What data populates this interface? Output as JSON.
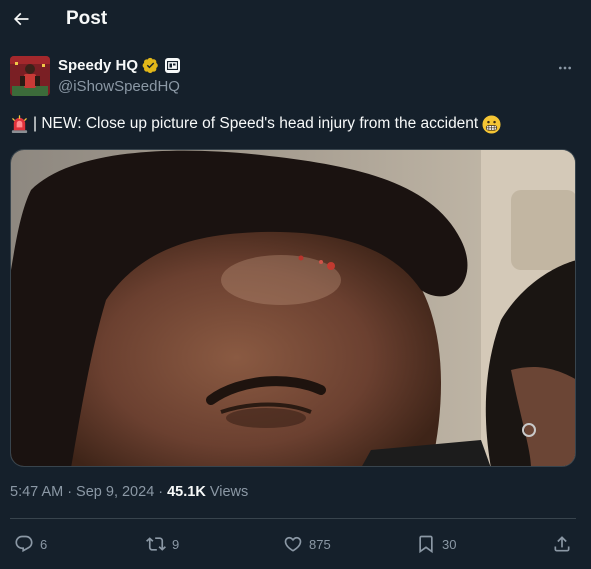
{
  "header": {
    "title": "Post"
  },
  "author": {
    "display_name": "Speedy HQ",
    "handle": "@iShowSpeedHQ"
  },
  "tweet": {
    "text": "| NEW: Close up picture of Speed's head injury from the accident"
  },
  "meta": {
    "time": "5:47 AM",
    "sep1": "·",
    "date": "Sep 9, 2024",
    "sep2": "·",
    "views_count": "45.1K",
    "views_label": "Views"
  },
  "actions": {
    "replies": "6",
    "reposts": "9",
    "likes": "875",
    "bookmarks": "30"
  },
  "colors": {
    "background": "#15202b",
    "text": "#f7f9f9",
    "muted": "#8b98a5",
    "border": "#38444d",
    "verified": "#e2b719"
  }
}
